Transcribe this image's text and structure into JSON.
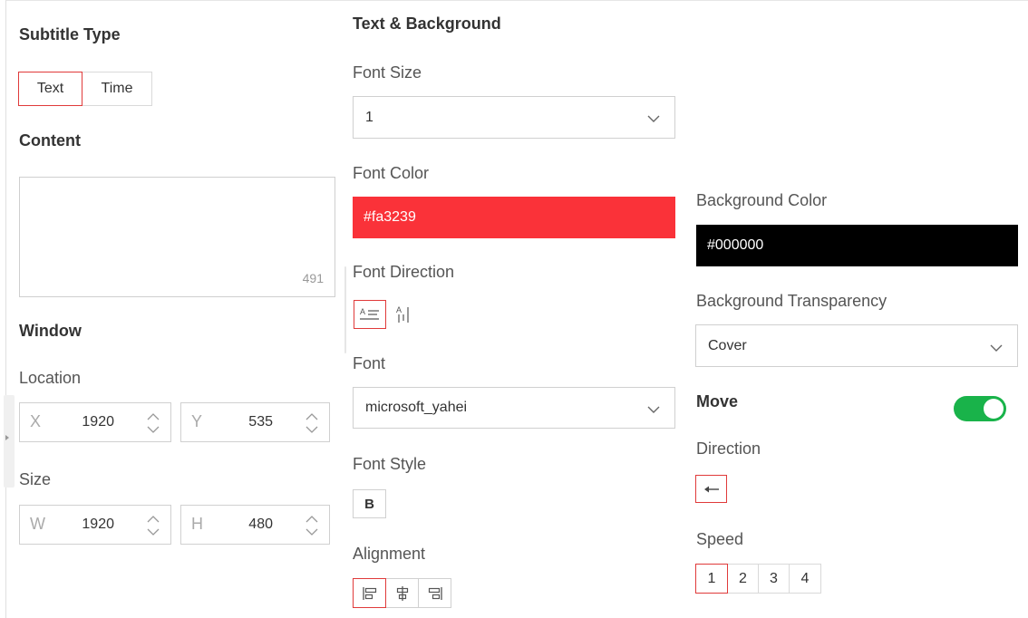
{
  "subtitle_type": {
    "heading": "Subtitle Type",
    "options": [
      "Text",
      "Time"
    ],
    "selected": "Text"
  },
  "content": {
    "heading": "Content",
    "value": "",
    "remaining_chars": "491"
  },
  "window": {
    "heading": "Window",
    "location": {
      "label": "Location",
      "x_prefix": "X",
      "x_value": "1920",
      "y_prefix": "Y",
      "y_value": "535"
    },
    "size": {
      "label": "Size",
      "w_prefix": "W",
      "w_value": "1920",
      "h_prefix": "H",
      "h_value": "480"
    }
  },
  "text_bg": {
    "heading": "Text & Background",
    "font_size": {
      "label": "Font Size",
      "value": "1"
    },
    "font_color": {
      "label": "Font Color",
      "value": "#fa3239",
      "color": "#fa3239"
    },
    "font_direction": {
      "label": "Font Direction",
      "options": [
        "horizontal",
        "vertical"
      ],
      "selected": "horizontal"
    },
    "font": {
      "label": "Font",
      "value": "microsoft_yahei"
    },
    "font_style": {
      "label": "Font Style",
      "bold_label": "B"
    },
    "alignment": {
      "label": "Alignment",
      "options": [
        "left",
        "center",
        "right"
      ],
      "selected": "left"
    }
  },
  "background": {
    "color": {
      "label": "Background Color",
      "value": "#000000",
      "color": "#000000"
    },
    "transparency": {
      "label": "Background Transparency",
      "value": "Cover"
    }
  },
  "move": {
    "label": "Move",
    "enabled": true,
    "direction": {
      "label": "Direction",
      "selected": "left"
    },
    "speed": {
      "label": "Speed",
      "options": [
        "1",
        "2",
        "3",
        "4"
      ],
      "selected": "1"
    }
  },
  "colors": {
    "accent": "#e03a3a",
    "toggle_on": "#19b34a"
  }
}
